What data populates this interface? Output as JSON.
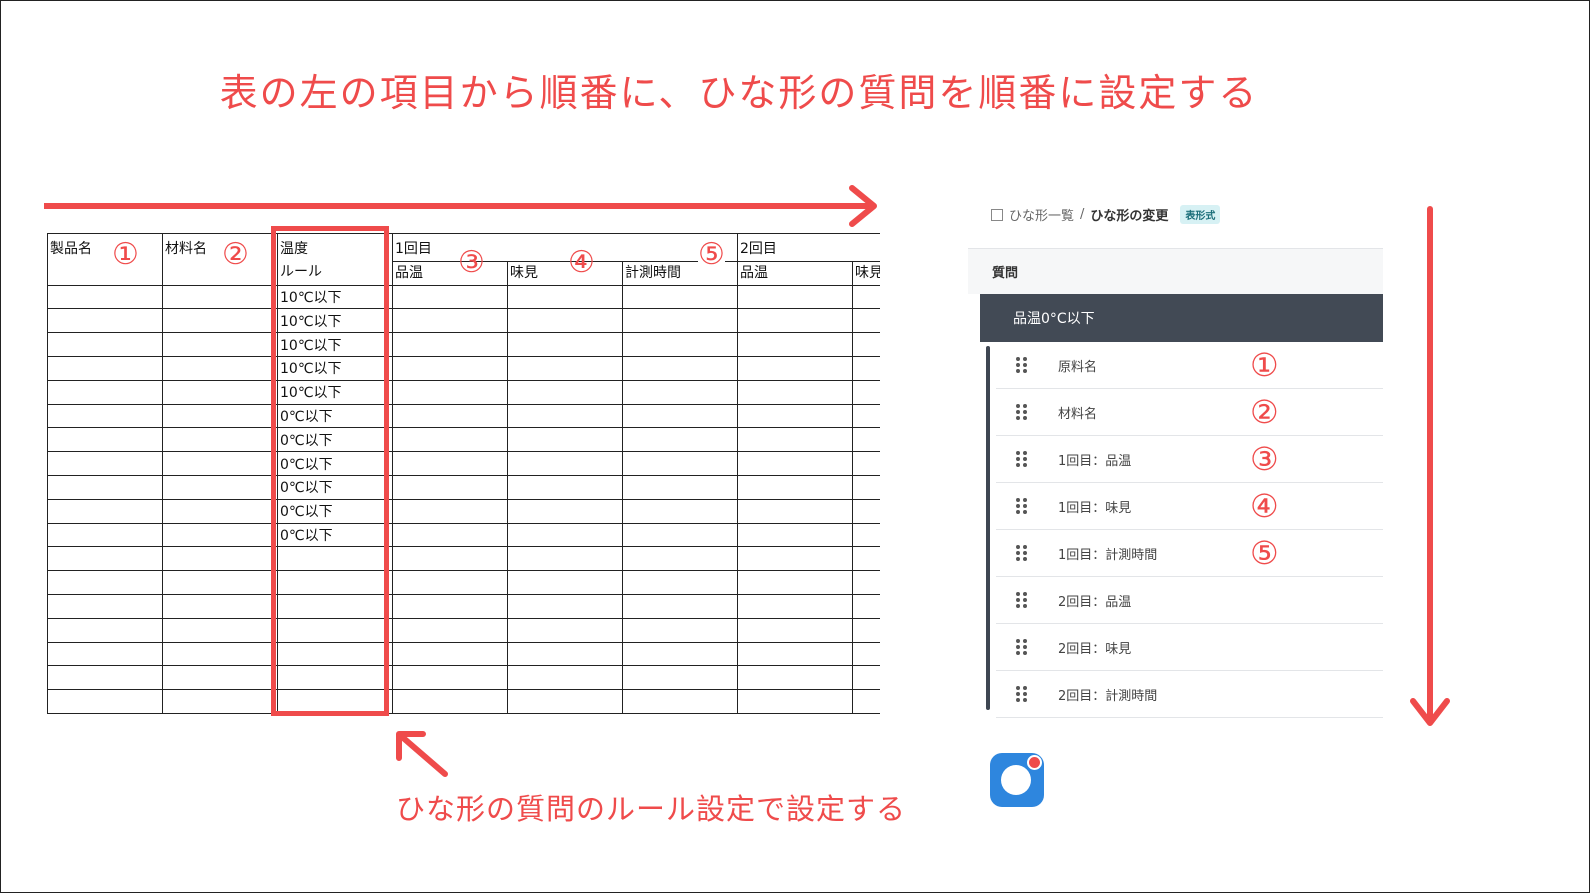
{
  "heading": "表の左の項目から順番に、ひな形の質問を順番に設定する",
  "caption": "ひな形の質問のルール設定で設定する",
  "sheet": {
    "h_product": "製品名",
    "h_material": "材料名",
    "h_temp_rule": "温度",
    "h_temp_rule2": "ルール",
    "h_round1": "1回目",
    "h_round2": "2回目",
    "h_hinon": "品温",
    "h_ajimi": "味見",
    "h_time": "計測時間",
    "h_hinon2": "品温",
    "h_ajimi2": "味見",
    "rules": [
      "10℃以下",
      "10℃以下",
      "10℃以下",
      "10℃以下",
      "10℃以下",
      "0℃以下",
      "0℃以下",
      "0℃以下",
      "0℃以下",
      "0℃以下",
      "0℃以下"
    ],
    "markers": [
      "①",
      "②",
      "③",
      "④",
      "⑤"
    ]
  },
  "breadcrumb": {
    "list": "ひな形一覧",
    "sep": "/",
    "current": "ひな形の変更",
    "badge": "表形式"
  },
  "panel": {
    "header": "質問",
    "selected": "品温0°C以下",
    "items": [
      {
        "label": "原料名",
        "marker": "①"
      },
      {
        "label": "材料名",
        "marker": "②"
      },
      {
        "label": "1回目：品温",
        "marker": "③"
      },
      {
        "label": "1回目：味見",
        "marker": "④"
      },
      {
        "label": "1回目：計測時間",
        "marker": "⑤"
      },
      {
        "label": "2回目：品温",
        "marker": ""
      },
      {
        "label": "2回目：味見",
        "marker": ""
      },
      {
        "label": "2回目：計測時間",
        "marker": ""
      }
    ]
  },
  "colors": {
    "accent": "#ef4b4b",
    "selected_bg": "#424a55"
  }
}
